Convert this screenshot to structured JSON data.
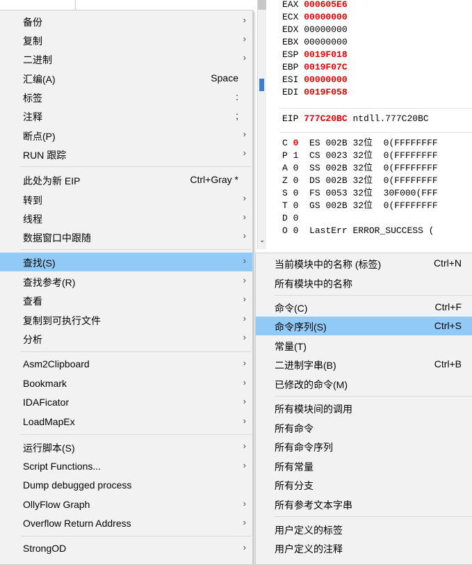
{
  "registers": [
    {
      "name": "EAX",
      "value": "000605E6",
      "highlight": true
    },
    {
      "name": "ECX",
      "value": "00000000",
      "highlight": true
    },
    {
      "name": "EDX",
      "value": "00000000",
      "highlight": false
    },
    {
      "name": "EBX",
      "value": "00000000",
      "highlight": false
    },
    {
      "name": "ESP",
      "value": "0019F018",
      "highlight": true
    },
    {
      "name": "EBP",
      "value": "0019F07C",
      "highlight": true
    },
    {
      "name": "ESI",
      "value": "00000000",
      "highlight": true
    },
    {
      "name": "EDI",
      "value": "0019F058",
      "highlight": true
    }
  ],
  "eip": {
    "name": "EIP",
    "value": "777C20BC",
    "desc": "ntdll.777C20BC"
  },
  "flags": [
    {
      "flag": "C",
      "val": "0",
      "seg": "ES 002B 32位  0(FFFFFFFF"
    },
    {
      "flag": "P",
      "val": "1",
      "seg": "CS 0023 32位  0(FFFFFFFF"
    },
    {
      "flag": "A",
      "val": "0",
      "seg": "SS 002B 32位  0(FFFFFFFF"
    },
    {
      "flag": "Z",
      "val": "0",
      "seg": "DS 002B 32位  0(FFFFFFFF"
    },
    {
      "flag": "S",
      "val": "0",
      "seg": "FS 0053 32位  30F000(FFF"
    },
    {
      "flag": "T",
      "val": "0",
      "seg": "GS 002B 32位  0(FFFFFFFF"
    },
    {
      "flag": "D",
      "val": "0",
      "seg": ""
    },
    {
      "flag": "O",
      "val": "0",
      "seg": "LastErr ERROR_SUCCESS ("
    }
  ],
  "colors": {
    "highlight": "#91c9f7",
    "menu_bg": "#f2f2f2",
    "reg_changed": "#e00000"
  },
  "main_menu": {
    "items": [
      {
        "label": "备份",
        "shortcut": "",
        "arrow": "›"
      },
      {
        "label": "复制",
        "shortcut": "",
        "arrow": "›"
      },
      {
        "label": "二进制",
        "shortcut": "",
        "arrow": "›"
      },
      {
        "label": "汇编(A)",
        "shortcut": "Space",
        "arrow": ""
      },
      {
        "label": "标签",
        "shortcut": ":",
        "arrow": ""
      },
      {
        "label": "注释",
        "shortcut": ";",
        "arrow": ""
      },
      {
        "label": "断点(P)",
        "shortcut": "",
        "arrow": "›"
      },
      {
        "label": "RUN 跟踪",
        "shortcut": "",
        "arrow": "›"
      },
      {
        "label": "此处为新 EIP",
        "shortcut": "Ctrl+Gray *",
        "arrow": ""
      },
      {
        "label": "转到",
        "shortcut": "",
        "arrow": "›"
      },
      {
        "label": "线程",
        "shortcut": "",
        "arrow": "›"
      },
      {
        "label": "数据窗口中跟随",
        "shortcut": "",
        "arrow": "›"
      },
      {
        "label": "查找(S)",
        "shortcut": "",
        "arrow": "›"
      },
      {
        "label": "查找参考(R)",
        "shortcut": "",
        "arrow": "›"
      },
      {
        "label": "查看",
        "shortcut": "",
        "arrow": "›"
      },
      {
        "label": "复制到可执行文件",
        "shortcut": "",
        "arrow": "›"
      },
      {
        "label": "分析",
        "shortcut": "",
        "arrow": "›"
      },
      {
        "label": "Asm2Clipboard",
        "shortcut": "",
        "arrow": "›"
      },
      {
        "label": "Bookmark",
        "shortcut": "",
        "arrow": "›"
      },
      {
        "label": "IDAFicator",
        "shortcut": "",
        "arrow": "›"
      },
      {
        "label": "LoadMapEx",
        "shortcut": "",
        "arrow": "›"
      },
      {
        "label": "运行脚本(S)",
        "shortcut": "",
        "arrow": "›"
      },
      {
        "label": "Script Functions...",
        "shortcut": "",
        "arrow": "›"
      },
      {
        "label": "Dump debugged process",
        "shortcut": "",
        "arrow": ""
      },
      {
        "label": "OllyFlow Graph",
        "shortcut": "",
        "arrow": "›"
      },
      {
        "label": "Overflow Return Address",
        "shortcut": "",
        "arrow": "›"
      },
      {
        "label": "StrongOD",
        "shortcut": "",
        "arrow": "›"
      }
    ]
  },
  "sub_menu": {
    "items": [
      {
        "label": "当前模块中的名称 (标签)",
        "shortcut": "Ctrl+N"
      },
      {
        "label": "所有模块中的名称",
        "shortcut": ""
      },
      {
        "label": "命令(C)",
        "shortcut": "Ctrl+F"
      },
      {
        "label": "命令序列(S)",
        "shortcut": "Ctrl+S"
      },
      {
        "label": "常量(T)",
        "shortcut": ""
      },
      {
        "label": "二进制字串(B)",
        "shortcut": "Ctrl+B"
      },
      {
        "label": "已修改的命令(M)",
        "shortcut": ""
      },
      {
        "label": "所有模块间的调用",
        "shortcut": ""
      },
      {
        "label": "所有命令",
        "shortcut": ""
      },
      {
        "label": "所有命令序列",
        "shortcut": ""
      },
      {
        "label": "所有常量",
        "shortcut": ""
      },
      {
        "label": "所有分支",
        "shortcut": ""
      },
      {
        "label": "所有参考文本字串",
        "shortcut": ""
      },
      {
        "label": "用户定义的标签",
        "shortcut": ""
      },
      {
        "label": "用户定义的注释",
        "shortcut": ""
      }
    ]
  }
}
